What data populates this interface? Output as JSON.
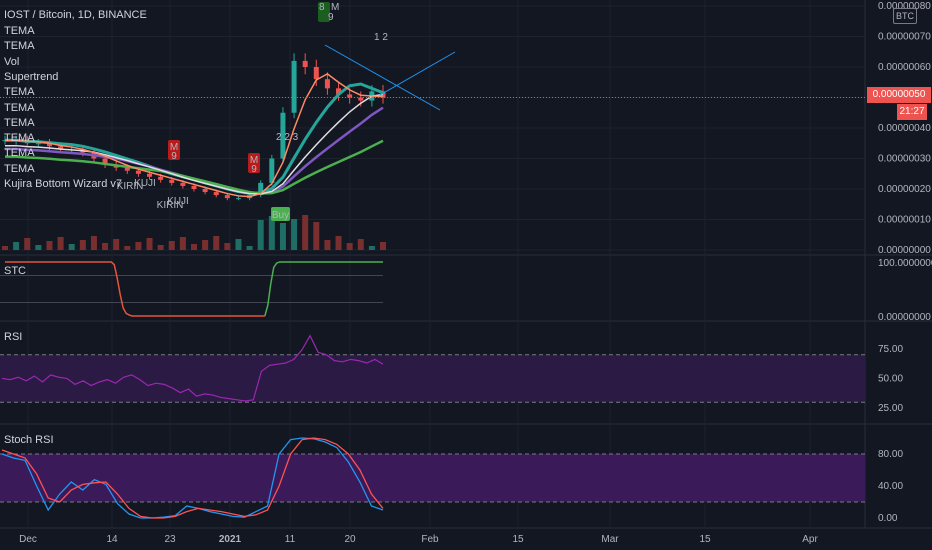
{
  "symbol_header": "IOST / Bitcoin, 1D, BINANCE",
  "indicator_legend": [
    "TEMA",
    "TEMA",
    "Vol",
    "Supertrend",
    "TEMA",
    "TEMA",
    "TEMA",
    "TEMA",
    "TEMA",
    "TEMA",
    "Kujira Bottom Wizard v7"
  ],
  "currency_badge": "BTC",
  "last_price_tag": "0.00000050",
  "countdown_tag": "21:27",
  "panes": {
    "stc": {
      "label": "STC"
    },
    "rsi": {
      "label": "RSI"
    },
    "stoch": {
      "label": "Stoch RSI"
    }
  },
  "colors": {
    "background": "#131722",
    "up": "#26a69a",
    "down": "#ef5350",
    "price_tag": "#ef5350",
    "rsi_band": "#2a1a44",
    "rsi_line": "#9c27b0",
    "stoch_band": "#3b1a5a",
    "stoch_k": "#2196f3",
    "stoch_d": "#ff5252",
    "stc_line": "#e6553a",
    "stc_line_up": "#4caf50"
  },
  "chart_markers": {
    "buy": "Buy",
    "kirin1": "KIRIN",
    "kuji1": "KUJI",
    "kirin2": "KIRIN",
    "kuji2": "KUJI",
    "m_top": "M",
    "m_count_top": "8",
    "m_nine_top": "9",
    "m1": "M",
    "m1_nine": "9",
    "m2": "M",
    "m2_nine": "9",
    "buy_counts": "2 2 3",
    "top_counts": "1 2"
  },
  "chart_data": [
    {
      "type": "candlestick",
      "title": "IOST / Bitcoin, 1D, BINANCE",
      "x": [
        "Dec",
        "14",
        "23",
        "2021",
        "11",
        "20",
        "Feb",
        "15",
        "Mar",
        "15",
        "Apr"
      ],
      "y_ticks": [
        "0.00000080",
        "0.00000070",
        "0.00000060",
        "0.00000050",
        "0.00000040",
        "0.00000030",
        "0.00000020",
        "0.00000010",
        "0.00000000"
      ],
      "ylim": [
        0,
        8e-07
      ],
      "close_approx": [
        3.6e-07,
        3.6e-07,
        3.5e-07,
        3.5e-07,
        3.4e-07,
        3.3e-07,
        3.3e-07,
        3.2e-07,
        3e-07,
        2.8e-07,
        2.7e-07,
        2.6e-07,
        2.5e-07,
        2.4e-07,
        2.3e-07,
        2.2e-07,
        2.1e-07,
        2e-07,
        1.9e-07,
        1.8e-07,
        1.7e-07,
        1.7e-07,
        1.8e-07,
        2.2e-07,
        3e-07,
        4.5e-07,
        6.2e-07,
        6e-07,
        5.6e-07,
        5.3e-07,
        5.1e-07,
        5e-07,
        4.9e-07,
        5.2e-07,
        5e-07
      ],
      "last_price": 5e-07
    },
    {
      "type": "line",
      "title": "STC",
      "y_ticks": [
        "100.00000000",
        "0.00000000"
      ],
      "ylim": [
        0,
        100
      ],
      "values": [
        100,
        100,
        100,
        100,
        100,
        100,
        100,
        100,
        100,
        100,
        100,
        100,
        100,
        100,
        100,
        100,
        100,
        100,
        100,
        100,
        100,
        100,
        100,
        100,
        100,
        100,
        100,
        100,
        100,
        100,
        100,
        100,
        100,
        100,
        100,
        100,
        100,
        95,
        70,
        40,
        15,
        5,
        2,
        0,
        0,
        0,
        0,
        0,
        0,
        0,
        0,
        0,
        0,
        0,
        0,
        0,
        0,
        0,
        0,
        0,
        0,
        0,
        0,
        0,
        0,
        0,
        0,
        0,
        0,
        0,
        0,
        0,
        0,
        0,
        0,
        0,
        0,
        0,
        0,
        0,
        0,
        0,
        0,
        0,
        0,
        0,
        0,
        0,
        0,
        20,
        60,
        90,
        98,
        100,
        100,
        100,
        100,
        100,
        100,
        100,
        100,
        100,
        100,
        100,
        100,
        100,
        100,
        100,
        100,
        100,
        100,
        100,
        100,
        100,
        100,
        100,
        100,
        100,
        100,
        100,
        100,
        100,
        100,
        100,
        100,
        100,
        100,
        100,
        100
      ]
    },
    {
      "type": "line",
      "title": "RSI",
      "y_ticks": [
        "75.00",
        "50.00",
        "25.00"
      ],
      "ylim": [
        15,
        95
      ],
      "bands": [
        30,
        70
      ],
      "values": [
        50,
        49,
        51,
        48,
        52,
        47,
        53,
        51,
        50,
        45,
        48,
        44,
        47,
        49,
        46,
        51,
        53,
        49,
        44,
        46,
        45,
        42,
        38,
        41,
        35,
        37,
        36,
        34,
        33,
        32,
        31,
        32,
        56,
        61,
        62,
        63,
        66,
        74,
        86,
        72,
        70,
        65,
        64,
        66,
        65,
        63,
        66,
        62
      ]
    },
    {
      "type": "line",
      "title": "Stoch RSI",
      "y_ticks": [
        "80.00",
        "40.00",
        "0.00"
      ],
      "ylim": [
        -5,
        110
      ],
      "bands": [
        20,
        80
      ],
      "series": [
        {
          "name": "K",
          "values": [
            80,
            75,
            72,
            40,
            10,
            30,
            45,
            35,
            48,
            42,
            18,
            5,
            0,
            0,
            1,
            3,
            15,
            12,
            8,
            5,
            2,
            1,
            8,
            15,
            80,
            98,
            100,
            99,
            95,
            88,
            70,
            45,
            15,
            10
          ]
        },
        {
          "name": "D",
          "values": [
            85,
            80,
            75,
            55,
            25,
            20,
            35,
            42,
            44,
            45,
            30,
            12,
            2,
            0,
            0,
            2,
            8,
            12,
            10,
            8,
            5,
            2,
            4,
            10,
            40,
            80,
            98,
            100,
            98,
            92,
            80,
            60,
            30,
            12
          ]
        }
      ]
    }
  ]
}
